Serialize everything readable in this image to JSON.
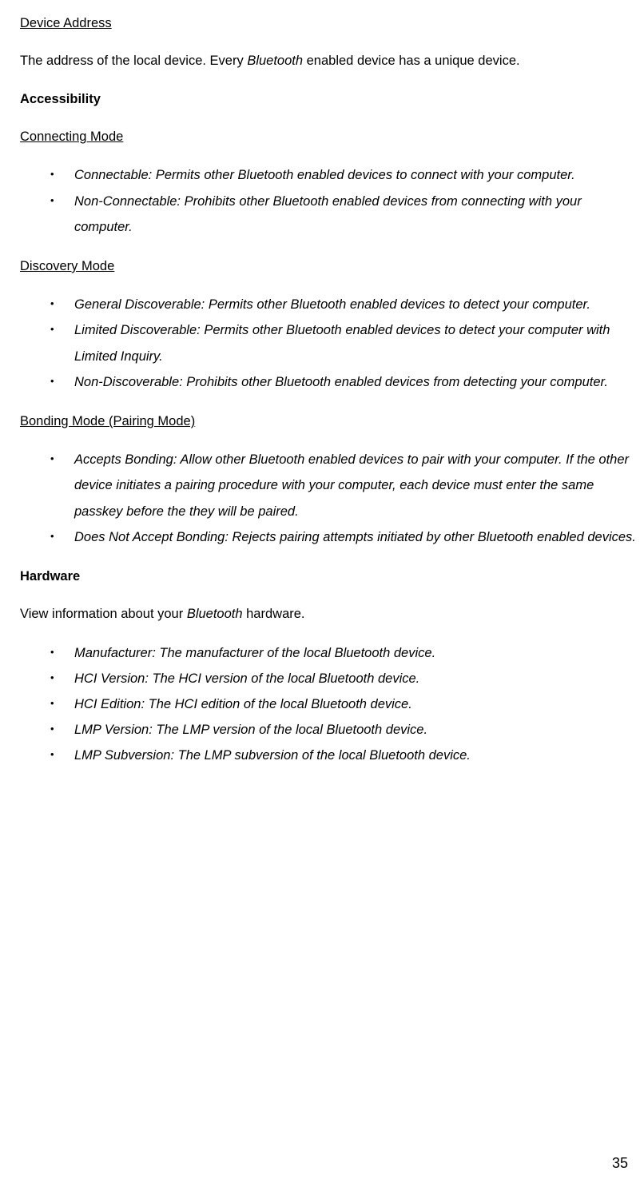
{
  "deviceAddress": {
    "heading": "Device Address",
    "text_before": "The address of the local device. Every ",
    "text_italic": "Bluetooth",
    "text_after": " enabled device has a unique device."
  },
  "accessibility": {
    "heading": "Accessibility",
    "connectingMode": {
      "heading": "Connecting Mode",
      "items": [
        "Connectable: Permits other Bluetooth enabled devices to connect with your computer.",
        "Non-Connectable: Prohibits other Bluetooth enabled devices from connecting with your computer."
      ]
    },
    "discoveryMode": {
      "heading": "Discovery Mode",
      "items": [
        "General Discoverable: Permits other Bluetooth enabled devices to detect your computer.",
        "Limited Discoverable: Permits other Bluetooth enabled devices to detect your computer with Limited Inquiry.",
        "Non-Discoverable: Prohibits other Bluetooth enabled devices from detecting your computer."
      ]
    },
    "bondingMode": {
      "heading": "Bonding Mode (Pairing Mode)",
      "items": [
        "Accepts Bonding: Allow other Bluetooth enabled devices to pair with your computer. If the other device initiates a pairing procedure with your computer, each device must enter the same passkey before the they will be paired.",
        "Does Not Accept Bonding: Rejects pairing attempts initiated by other Bluetooth enabled devices."
      ]
    }
  },
  "hardware": {
    "heading": "Hardware",
    "text_before": "View information about your ",
    "text_italic": "Bluetooth",
    "text_after": " hardware.",
    "items": [
      "Manufacturer: The manufacturer of the local Bluetooth device.",
      "HCI Version: The HCI version of the local Bluetooth device.",
      "HCI Edition:   The HCI edition of the local Bluetooth device.",
      "LMP Version: The LMP version of the local Bluetooth device.",
      "LMP Subversion: The LMP subversion of the local Bluetooth device."
    ]
  },
  "pageNumber": "35"
}
